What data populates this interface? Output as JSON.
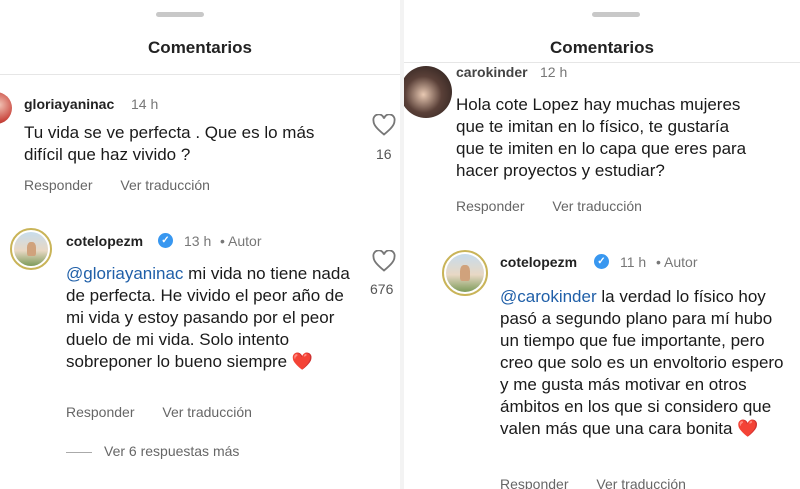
{
  "left": {
    "title": "Comentarios",
    "comment1": {
      "username": "gloriayaninac",
      "time": "14 h",
      "text": "Tu vida se ve perfecta . Que es lo más difícil que haz vivido ?",
      "reply_label": "Responder",
      "translate_label": "Ver traducción",
      "likes": "16"
    },
    "reply1": {
      "username": "cotelopezm",
      "time": "13 h",
      "author": "• Autor",
      "mention": "@gloriayaninac",
      "text": " mi vida no tiene nada de perfecta. He vivido el peor año de mi vida y estoy pasando por el peor duelo de mi vida. Solo intento sobreponer lo bueno siempre ",
      "emoji": "❤️",
      "reply_label": "Responder",
      "translate_label": "Ver traducción",
      "likes": "676"
    },
    "more_replies": "Ver 6 respuestas más"
  },
  "right": {
    "title": "Comentarios",
    "comment1": {
      "username": "carokinder",
      "time": "12 h",
      "text": "Hola cote Lopez hay muchas mujeres que te imitan en lo físico, te gustaría que te imiten en lo capa que eres para hacer proyectos y estudiar?",
      "reply_label": "Responder",
      "translate_label": "Ver traducción"
    },
    "reply1": {
      "username": "cotelopezm",
      "time": "11 h",
      "author": "• Autor",
      "mention": "@carokinder",
      "text": " la verdad lo físico hoy pasó a segundo plano para mí hubo un tiempo que fue importante, pero creo que solo es un envoltorio espero y me gusta más motivar en otros ámbitos en los que si considero que valen más que una cara bonita ",
      "emoji": "❤️",
      "reply_label": "Responder",
      "translate_label": "Ver traducción"
    }
  },
  "icons": {
    "heart": "heart-outline-icon",
    "verified": "verified-badge-icon",
    "emoji": "red-heart-emoji"
  }
}
